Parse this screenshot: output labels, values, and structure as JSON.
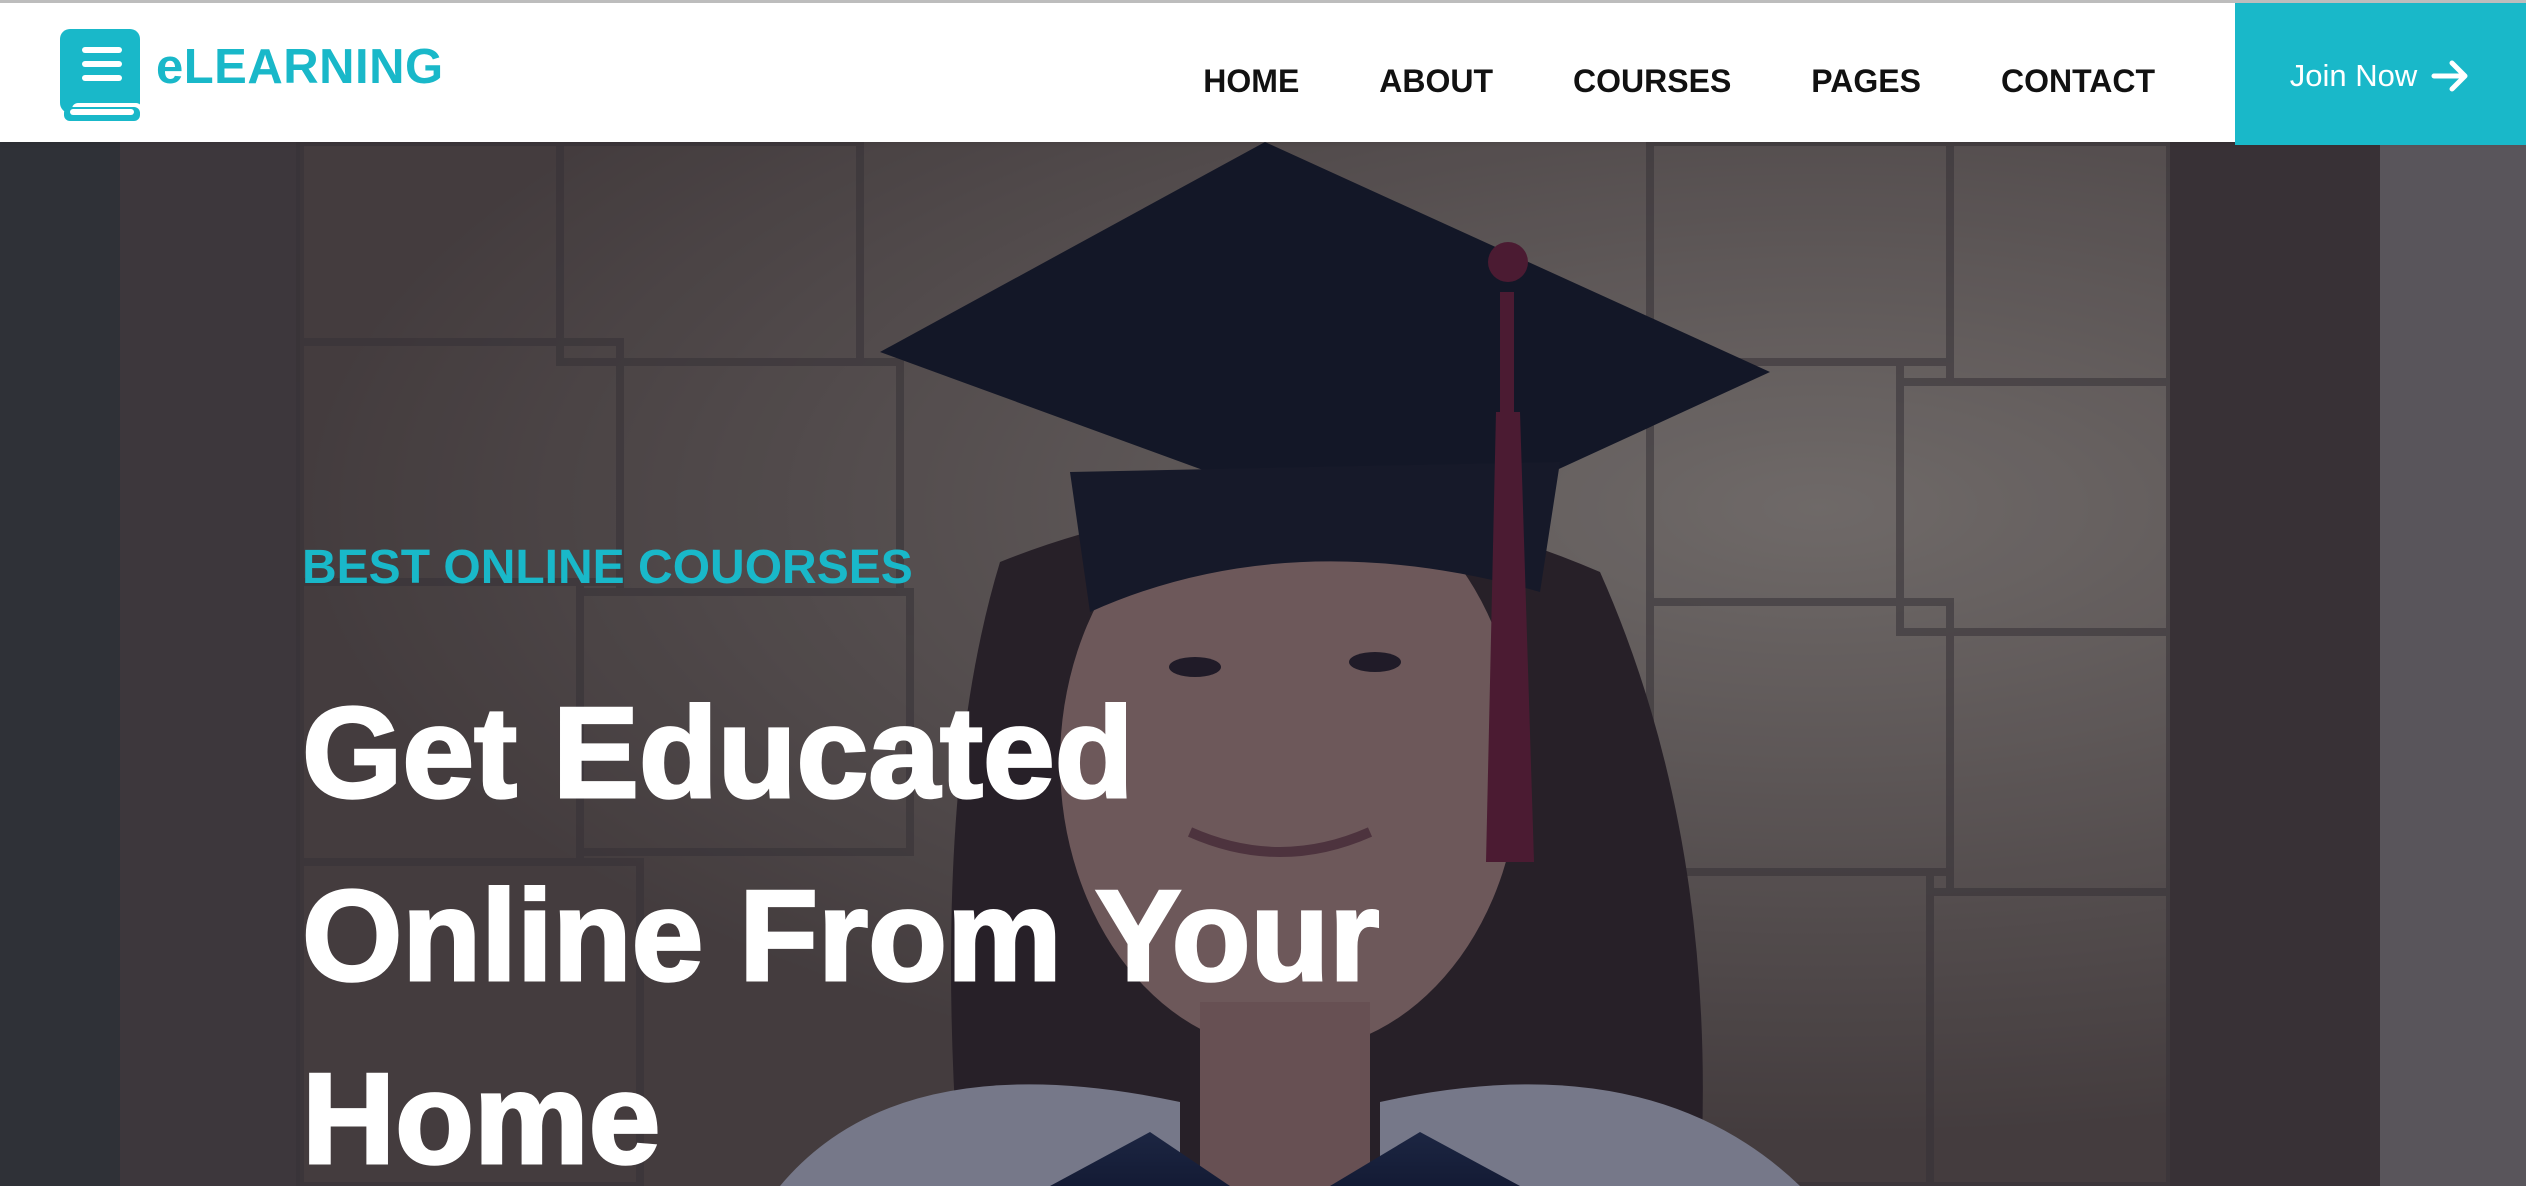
{
  "brand": {
    "name": "eLEARNING",
    "icon": "book-icon",
    "color": "#19b8c9"
  },
  "nav": {
    "items": [
      {
        "label": "HOME"
      },
      {
        "label": "ABOUT"
      },
      {
        "label": "COURSES"
      },
      {
        "label": "PAGES"
      },
      {
        "label": "CONTACT"
      }
    ],
    "join_label": "Join Now",
    "join_icon": "arrow-right-icon",
    "accent": "#19b8c9"
  },
  "hero": {
    "subtitle": "BEST ONLINE COUORSES",
    "title_lines": [
      "Get Educated",
      "Online From Your",
      "Home"
    ],
    "subtitle_color": "#19b8c9",
    "title_color": "#ffffff"
  }
}
